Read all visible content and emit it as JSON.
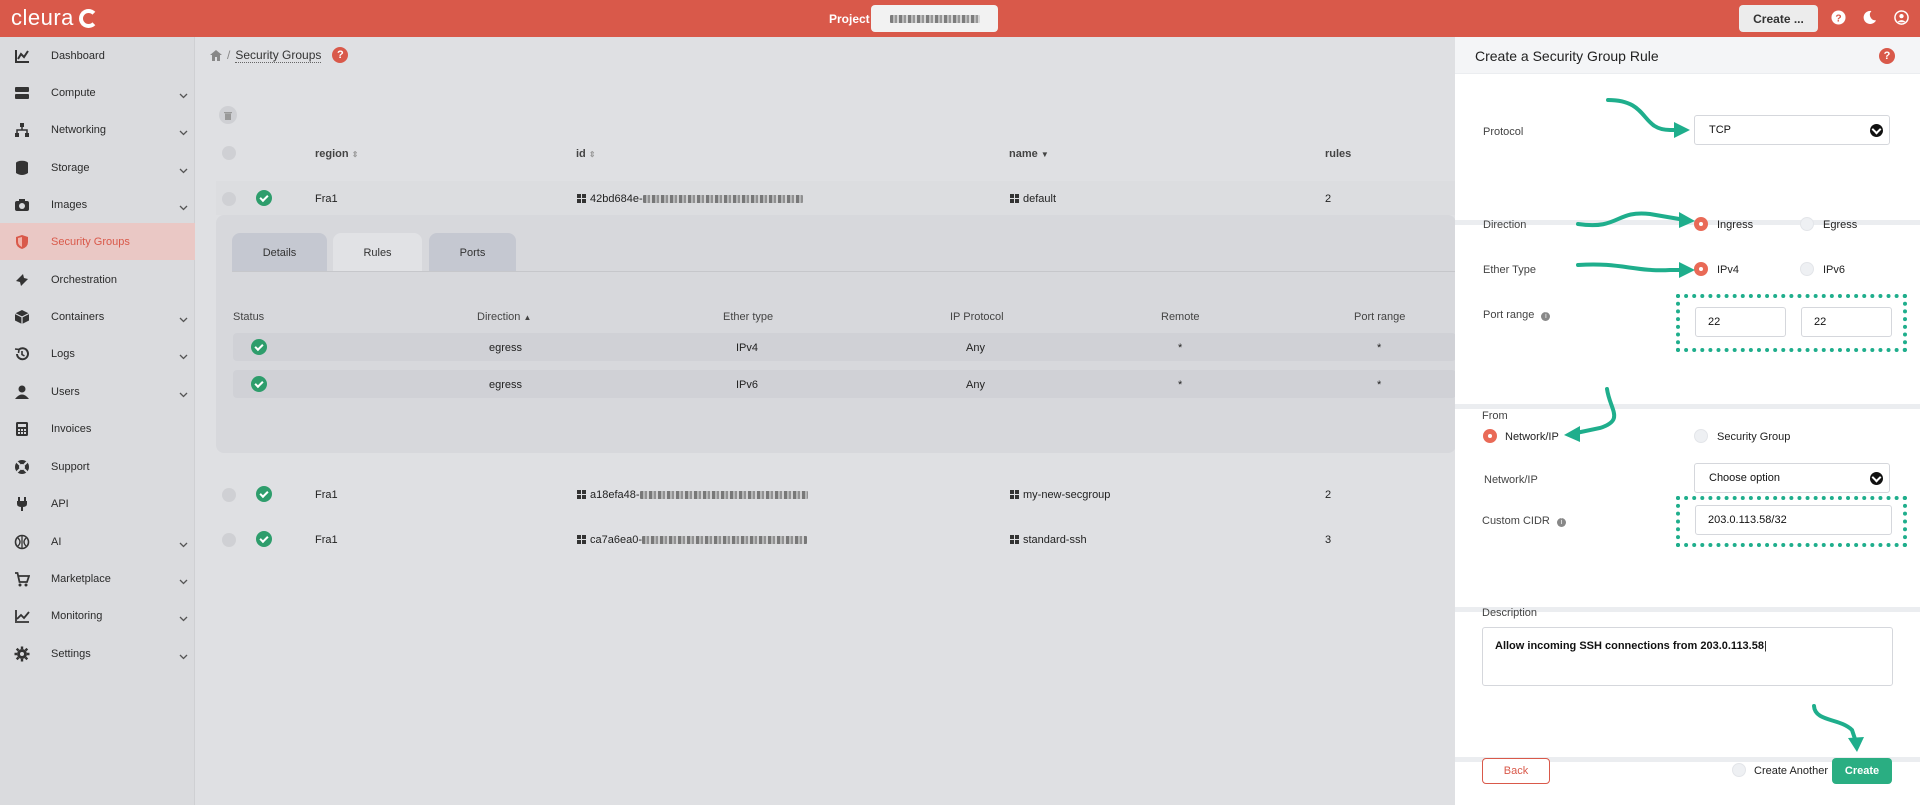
{
  "brand": {
    "name": "cleura"
  },
  "topbar": {
    "project_label": "Project",
    "create_label": "Create ..."
  },
  "sidebar": {
    "items": [
      {
        "label": "Dashboard",
        "icon": "chart-icon",
        "expandable": false
      },
      {
        "label": "Compute",
        "icon": "server-icon",
        "expandable": true
      },
      {
        "label": "Networking",
        "icon": "network-icon",
        "expandable": true
      },
      {
        "label": "Storage",
        "icon": "database-icon",
        "expandable": true
      },
      {
        "label": "Images",
        "icon": "camera-icon",
        "expandable": true
      },
      {
        "label": "Security Groups",
        "icon": "shield-icon",
        "expandable": false,
        "active": true
      },
      {
        "label": "Orchestration",
        "icon": "orchestration-icon",
        "expandable": false
      },
      {
        "label": "Containers",
        "icon": "cube-icon",
        "expandable": true
      },
      {
        "label": "Logs",
        "icon": "history-icon",
        "expandable": true
      },
      {
        "label": "Users",
        "icon": "user-icon",
        "expandable": true
      },
      {
        "label": "Invoices",
        "icon": "calculator-icon",
        "expandable": false
      },
      {
        "label": "Support",
        "icon": "lifebuoy-icon",
        "expandable": false
      },
      {
        "label": "API",
        "icon": "plug-icon",
        "expandable": false
      },
      {
        "label": "AI",
        "icon": "ai-icon",
        "expandable": true
      },
      {
        "label": "Marketplace",
        "icon": "cart-icon",
        "expandable": true
      },
      {
        "label": "Monitoring",
        "icon": "line-chart-icon",
        "expandable": true
      },
      {
        "label": "Settings",
        "icon": "gear-icon",
        "expandable": true
      }
    ]
  },
  "breadcrumb": {
    "title": "Security Groups"
  },
  "table": {
    "headers": {
      "region": "region",
      "id": "id",
      "name": "name",
      "rules": "rules"
    },
    "rows": [
      {
        "region": "Fra1",
        "id_prefix": "42bd684e-",
        "name": "default",
        "rules": "2"
      },
      {
        "region": "Fra1",
        "id_prefix": "a18efa48-",
        "name": "my-new-secgroup",
        "rules": "2"
      },
      {
        "region": "Fra1",
        "id_prefix": "ca7a6ea0-",
        "name": "standard-ssh",
        "rules": "3"
      }
    ]
  },
  "detail_tabs": [
    "Details",
    "Rules",
    "Ports"
  ],
  "rules_table": {
    "headers": [
      "Status",
      "Direction",
      "Ether type",
      "IP Protocol",
      "Remote",
      "Port range"
    ],
    "rows": [
      [
        "egress",
        "IPv4",
        "Any",
        "*",
        "*"
      ],
      [
        "egress",
        "IPv6",
        "Any",
        "*",
        "*"
      ]
    ]
  },
  "panel": {
    "title": "Create a Security Group Rule",
    "protocol_label": "Protocol",
    "protocol_value": "TCP",
    "direction_label": "Direction",
    "direction_options": [
      "Ingress",
      "Egress"
    ],
    "ether_label": "Ether Type",
    "ether_options": [
      "IPv4",
      "IPv6"
    ],
    "port_label": "Port range",
    "port_from": "22",
    "port_to": "22",
    "from_label": "From",
    "from_options": [
      "Network/IP",
      "Security Group"
    ],
    "network_label": "Network/IP",
    "network_placeholder": "Choose option",
    "cidr_label": "Custom CIDR",
    "cidr_value": "203.0.113.58/32",
    "description_label": "Description",
    "description_value": "Allow incoming SSH connections from 203.0.113.58",
    "back_label": "Back",
    "create_another_label": "Create Another",
    "create_label": "Create"
  },
  "colors": {
    "brand": "#d9594a",
    "accent_green": "#2aae82",
    "annotation": "#1fae8c"
  }
}
